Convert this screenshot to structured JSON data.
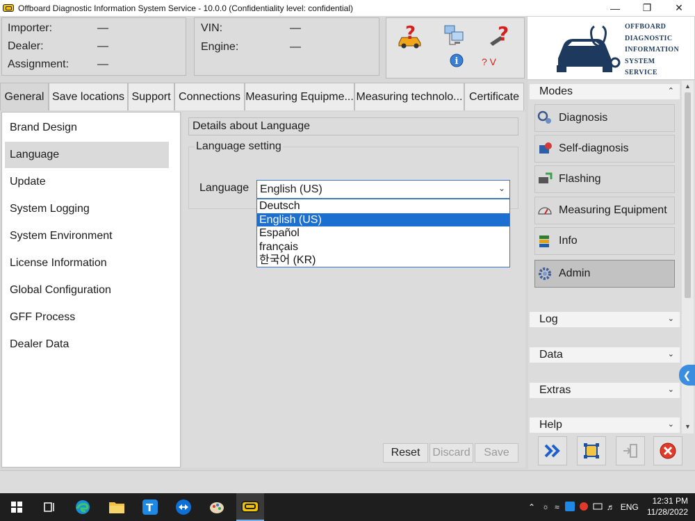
{
  "window": {
    "title": "Offboard Diagnostic Information System Service - 10.0.0 (Confidentiality level: confidential)",
    "minimize": "—",
    "restore": "❐",
    "close": "✕"
  },
  "header": {
    "importer_label": "Importer:",
    "importer_value": "—",
    "dealer_label": "Dealer:",
    "dealer_value": "—",
    "assignment_label": "Assignment:",
    "assignment_value": "—",
    "vin_label": "VIN:",
    "vin_value": "—",
    "engine_label": "Engine:",
    "engine_value": "—",
    "version_icon_text": "? V",
    "logo_lines": [
      "OFFBOARD",
      "DIAGNOSTIC",
      "INFORMATION",
      "SYSTEM",
      "SERVICE"
    ]
  },
  "tabs": [
    "General",
    "Save locations",
    "Support",
    "Connections",
    "Measuring Equipme...",
    "Measuring technolo...",
    "Certificate"
  ],
  "left_items": [
    "Brand Design",
    "Language",
    "Update",
    "System Logging",
    "System Environment",
    "License Information",
    "Global Configuration",
    "GFF Process",
    "Dealer Data"
  ],
  "content": {
    "section_title": "Details about Language",
    "group_title": "Language setting",
    "language_label": "Language",
    "selected_language": "English (US)",
    "options": [
      "Deutsch",
      "English (US)",
      "Español",
      "français",
      "한국어 (KR)"
    ],
    "reset": "Reset",
    "discard": "Discard",
    "save": "Save"
  },
  "right_panel": {
    "modes_label": "Modes",
    "modes": [
      "Diagnosis",
      "Self-diagnosis",
      "Flashing",
      "Measuring Equipment",
      "Info",
      "Admin"
    ],
    "log_label": "Log",
    "data_label": "Data",
    "extras_label": "Extras",
    "help_label": "Help"
  },
  "taskbar": {
    "lang": "ENG",
    "time": "12:31 PM",
    "date": "11/28/2022"
  },
  "colors": {
    "accent": "#1b6fd1",
    "logo": "#1d3a5e",
    "close_btn": "#e03a2a"
  }
}
